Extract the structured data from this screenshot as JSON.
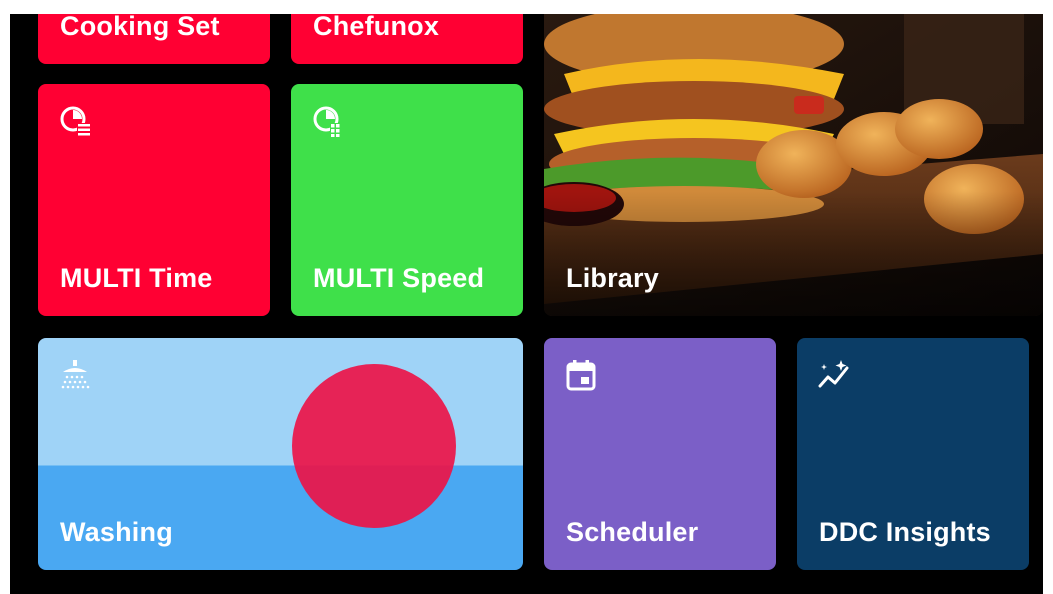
{
  "tiles": {
    "cooking_set": {
      "label": "Cooking Set",
      "color": "#ff0033"
    },
    "chefunox": {
      "label": "Chefunox",
      "color": "#ff0033"
    },
    "multi_time": {
      "label": "MULTI Time",
      "icon": "pie-clock-list-icon",
      "color": "#ff0033"
    },
    "multi_speed": {
      "label": "MULTI Speed",
      "icon": "pie-clock-grid-icon",
      "color": "#3fe04a"
    },
    "library": {
      "label": "Library",
      "image": "burger-with-nuggets-photo"
    },
    "washing": {
      "label": "Washing",
      "icon": "shower-icon",
      "color": "#9fd3f7"
    },
    "scheduler": {
      "label": "Scheduler",
      "icon": "calendar-icon",
      "color": "#7b5fc7"
    },
    "ddc_insights": {
      "label": "DDC Insights",
      "icon": "sparkle-trend-icon",
      "color": "#0b3d66"
    }
  },
  "touch_indicator": {
    "color": "#ec1448"
  }
}
